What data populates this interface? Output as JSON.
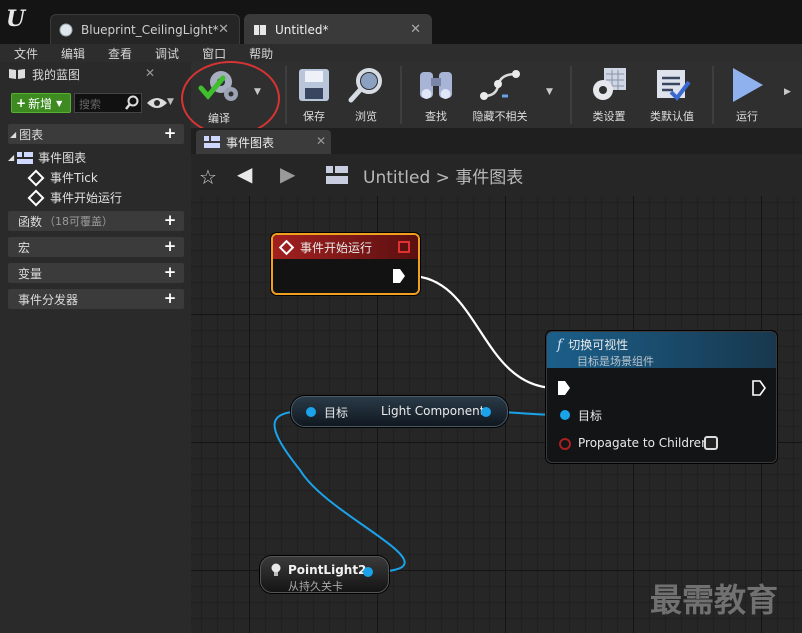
{
  "tabs": [
    {
      "label": "Blueprint_CeilingLight*"
    },
    {
      "label": "Untitled*"
    }
  ],
  "menu": [
    "文件",
    "编辑",
    "查看",
    "调试",
    "窗口",
    "帮助"
  ],
  "left_panel": {
    "title": "我的蓝图",
    "new_label": "新增",
    "search_placeholder": "搜索",
    "sections": {
      "graphs": "图表",
      "event_graph": "事件图表",
      "event_tick": "事件Tick",
      "event_begin": "事件开始运行",
      "functions": "函数",
      "functions_note": "（18可覆盖）",
      "macros": "宏",
      "variables": "变量",
      "dispatchers": "事件分发器"
    }
  },
  "toolbar": {
    "compile": "编译",
    "save": "保存",
    "browse": "浏览",
    "find": "查找",
    "hide_unrelated": "隐藏不相关",
    "class_settings": "类设置",
    "class_defaults": "类默认值",
    "play": "运行"
  },
  "graph_tab": "事件图表",
  "breadcrumb": {
    "root": "Untitled",
    "sep": ">",
    "current": "事件图表"
  },
  "nodes": {
    "begin_play": {
      "title": "事件开始运行"
    },
    "set_visibility": {
      "title": "切换可视性",
      "subtitle": "目标是场景组件",
      "target": "目标",
      "propagate": "Propagate to Children"
    },
    "get_component": {
      "target": "目标",
      "output": "Light Component"
    },
    "point_light": {
      "title": "PointLight2",
      "subtitle": "从持久关卡"
    }
  },
  "watermark": "最需教育",
  "colors": {
    "accent_green": "#3d8b20",
    "event_red": "#8b1a1a",
    "func_blue": "#1b5f8a",
    "exec_white": "#ffffff",
    "object_pin": "#1aa3ea",
    "highlight_ring": "#d63434"
  }
}
